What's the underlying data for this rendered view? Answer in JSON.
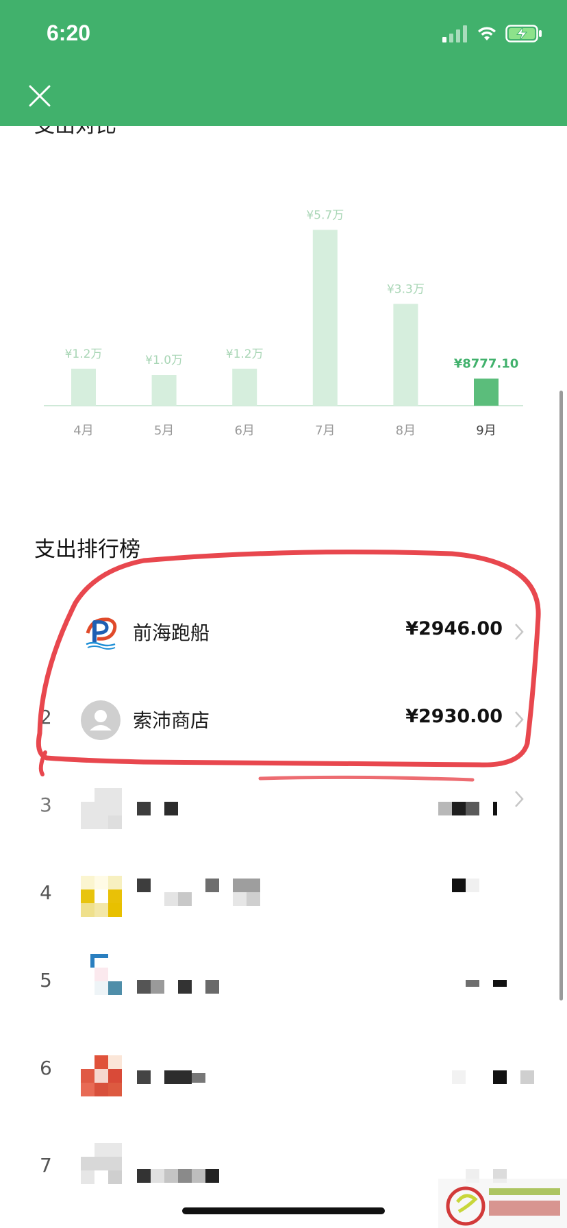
{
  "status_bar": {
    "time": "6:20"
  },
  "header": {
    "close_icon": "close-icon"
  },
  "section_prev": {
    "title": "支出对比"
  },
  "chart_data": {
    "type": "bar",
    "categories": [
      "4月",
      "5月",
      "6月",
      "7月",
      "8月",
      "9月"
    ],
    "values": [
      12000,
      10000,
      12000,
      57000,
      33000,
      8777.1
    ],
    "value_labels": [
      "¥1.2万",
      "¥1.0万",
      "¥1.2万",
      "¥5.7万",
      "¥3.3万",
      "¥8777.10"
    ],
    "highlight_index": 5,
    "colors": {
      "bar": "#d6eedd",
      "bar_highlight": "#5bbd7b",
      "label": "#a9d6b6",
      "label_highlight": "#41b16c",
      "axis": "#cfe9d8"
    },
    "ylim": [
      0,
      60000
    ]
  },
  "ranking": {
    "title": "支出排行榜",
    "items": [
      {
        "rank": "",
        "name": "前海跑船",
        "amount": "¥2946.00",
        "avatar": "merchant-logo-icon"
      },
      {
        "rank": "2",
        "name": "索沛商店",
        "amount": "¥2930.00",
        "avatar": "default-user-icon"
      },
      {
        "rank": "3",
        "name": "",
        "amount": "",
        "avatar": "pixelated-avatar"
      },
      {
        "rank": "4",
        "name": "",
        "amount": "",
        "avatar": "pixelated-avatar"
      },
      {
        "rank": "5",
        "name": "",
        "amount": "",
        "avatar": "pixelated-avatar"
      },
      {
        "rank": "6",
        "name": "",
        "amount": "",
        "avatar": "pixelated-avatar"
      },
      {
        "rank": "7",
        "name": "",
        "amount": "",
        "avatar": "pixelated-avatar"
      }
    ]
  },
  "colors": {
    "header": "#41b16c",
    "annotation": "#e8474e"
  }
}
